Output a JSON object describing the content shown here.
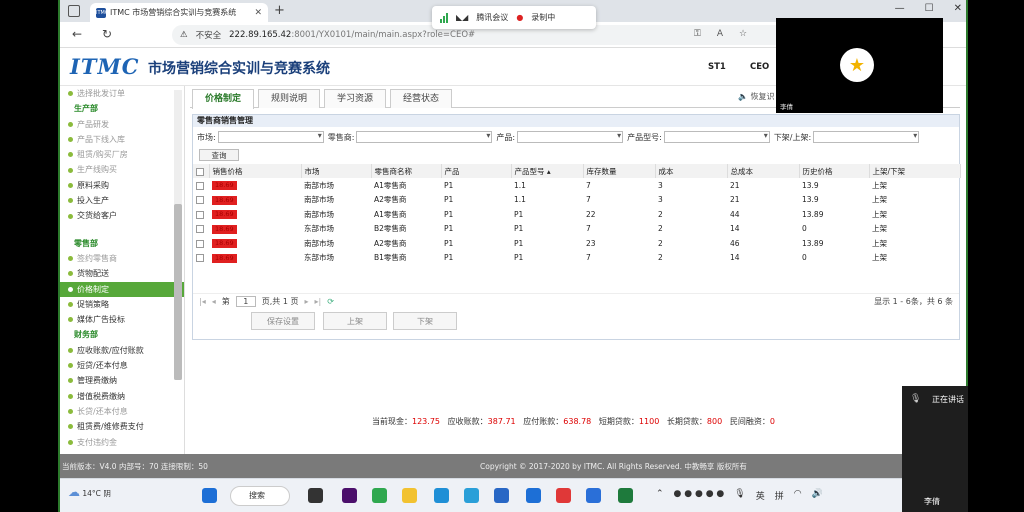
{
  "browser": {
    "tab_title": "ITMC 市场营销综合实训与竞赛系统",
    "tab_favicon": "ITMC",
    "insecure_label": "不安全",
    "url_host": "222.89.165.42",
    "url_rest": ":8001/YX0101/main/main.aspx?role=CEO#"
  },
  "meeting": {
    "app_label": "腾讯会议",
    "recording_label": "录制中",
    "participant_name": "李倩",
    "speaking_label": "正在讲话",
    "self_name": "李倩"
  },
  "app": {
    "logo": "ITMC",
    "title": "市场营销综合实训与竞赛系统",
    "nav": [
      "ST1",
      "CEO"
    ],
    "version_info": "当前版本：V4.0 内部号：70 连接限制：50",
    "copyright": "Copyright © 2017-2020 by ITMC. All Rights Reserved. 中教畅享 版权所有"
  },
  "sidebar": {
    "items": [
      {
        "label": "选择批发订单",
        "type": "dim"
      },
      {
        "label": "生产部",
        "type": "head"
      },
      {
        "label": "产品研发",
        "type": "dim"
      },
      {
        "label": "产品下线入库",
        "type": "dim"
      },
      {
        "label": "租赁/购买厂房",
        "type": "dim"
      },
      {
        "label": "生产线购买",
        "type": "dim"
      },
      {
        "label": "原料采购",
        "type": "normal"
      },
      {
        "label": "投入生产",
        "type": "normal"
      },
      {
        "label": "交货给客户",
        "type": "normal"
      },
      {
        "label": "",
        "type": "spacer"
      },
      {
        "label": "零售部",
        "type": "head"
      },
      {
        "label": "签约零售商",
        "type": "dim"
      },
      {
        "label": "货物配送",
        "type": "normal"
      },
      {
        "label": "价格制定",
        "type": "active"
      },
      {
        "label": "促销策略",
        "type": "normal"
      },
      {
        "label": "媒体广告投标",
        "type": "normal"
      },
      {
        "label": "财务部",
        "type": "head"
      },
      {
        "label": "应收账款/应付账款",
        "type": "normal"
      },
      {
        "label": "短贷/还本付息",
        "type": "normal"
      },
      {
        "label": "管理费缴纳",
        "type": "normal"
      },
      {
        "label": "增值税费缴纳",
        "type": "normal"
      },
      {
        "label": "长贷/还本付息",
        "type": "dim"
      },
      {
        "label": "租赁费/维修费支付",
        "type": "normal"
      },
      {
        "label": "支付违约金",
        "type": "dim"
      }
    ]
  },
  "tabs": [
    "价格制定",
    "规则说明",
    "学习资源",
    "经营状态"
  ],
  "recognizing_label": "恢复识",
  "panel": {
    "title": "零售商销售管理",
    "filters": {
      "market": "市场:",
      "retailer": "零售商:",
      "product": "产品:",
      "model": "产品型号:",
      "status": "下架/上架:"
    },
    "query_button": "查询",
    "columns": [
      "销售价格",
      "市场",
      "零售商名称",
      "产品",
      "产品型号",
      "库存数量",
      "成本",
      "总成本",
      "历史价格",
      "上架/下架"
    ],
    "rows": [
      [
        "18.69",
        "南部市场",
        "A1零售商",
        "P1",
        "1.1",
        "7",
        "3",
        "21",
        "13.9",
        "上架"
      ],
      [
        "18.69",
        "南部市场",
        "A2零售商",
        "P1",
        "1.1",
        "7",
        "3",
        "21",
        "13.9",
        "上架"
      ],
      [
        "18.69",
        "南部市场",
        "A1零售商",
        "P1",
        "P1",
        "22",
        "2",
        "44",
        "13.89",
        "上架"
      ],
      [
        "18.69",
        "东部市场",
        "B2零售商",
        "P1",
        "P1",
        "7",
        "2",
        "14",
        "0",
        "上架"
      ],
      [
        "18.69",
        "南部市场",
        "A2零售商",
        "P1",
        "P1",
        "23",
        "2",
        "46",
        "13.89",
        "上架"
      ],
      [
        "18.69",
        "东部市场",
        "B1零售商",
        "P1",
        "P1",
        "7",
        "2",
        "14",
        "0",
        "上架"
      ]
    ],
    "pager": {
      "page_label": "第",
      "page_value": "1",
      "total_label": "页,共 1 页",
      "info": "显示 1 - 6条，共 6 条"
    },
    "buttons": [
      "保存设置",
      "上架",
      "下架"
    ]
  },
  "summary": {
    "cash_label": "当前现金：",
    "cash": "123.75",
    "recv_label": "应收账款：",
    "recv": "387.71",
    "pay_label": "应付账款：",
    "pay": "638.78",
    "short_label": "短期贷款：",
    "short": "1100",
    "long_label": "长期贷款：",
    "long": "800",
    "private_label": "民间融资：",
    "private": "0"
  },
  "taskbar": {
    "temperature": "14°C",
    "weather": "阴",
    "search_label": "搜索",
    "ime_lang": "英",
    "ime_mode": "拼"
  }
}
